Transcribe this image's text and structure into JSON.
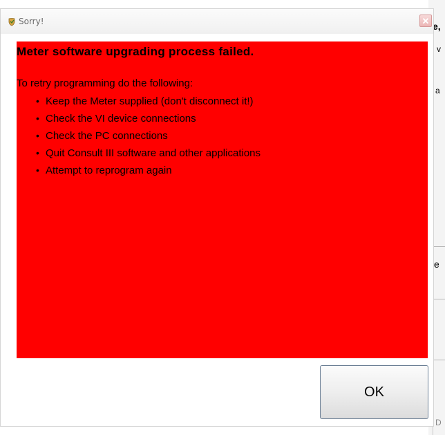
{
  "background_window": {
    "fragments": [
      "e,",
      "v",
      "a",
      "e",
      "D"
    ]
  },
  "dialog": {
    "title": "Sorry!",
    "close_glyph": "✕",
    "heading": "Meter software upgrading process failed.",
    "intro": "To retry programming do the following:",
    "steps": [
      "Keep the Meter supplied (don't disconnect it!)",
      "Check the VI device connections",
      "Check the PC connections",
      "Quit Consult III software and other applications",
      "Attempt to reprogram again"
    ],
    "ok_label": "OK"
  },
  "colors": {
    "message_background": "#ff0000",
    "close_button": "#ecb6b6"
  },
  "icons": {
    "title_icon": "app-shield-icon",
    "close_icon": "close-icon"
  }
}
